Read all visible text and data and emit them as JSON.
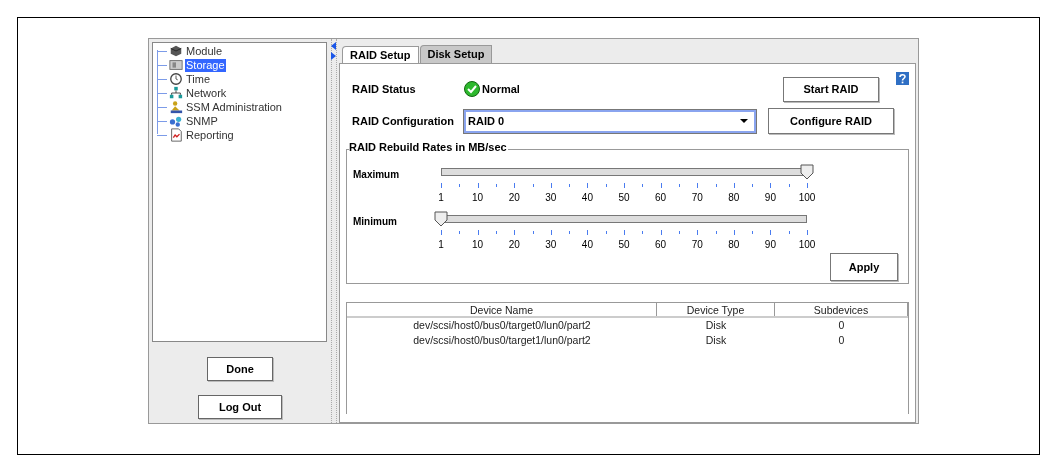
{
  "tree": [
    {
      "label": "Module",
      "kind": "module",
      "selected": false
    },
    {
      "label": "Storage",
      "kind": "storage",
      "selected": true
    },
    {
      "label": "Time",
      "kind": "time",
      "selected": false
    },
    {
      "label": "Network",
      "kind": "network",
      "selected": false
    },
    {
      "label": "SSM Administration",
      "kind": "admin",
      "selected": false
    },
    {
      "label": "SNMP",
      "kind": "snmp",
      "selected": false
    },
    {
      "label": "Reporting",
      "kind": "report",
      "selected": false
    }
  ],
  "side_buttons": [
    "Done",
    "Log Out"
  ],
  "tabs": [
    {
      "label": "RAID Setup",
      "selected": true
    },
    {
      "label": "Disk Setup",
      "selected": false
    }
  ],
  "raid_status": {
    "label": "RAID Status",
    "value": "Normal",
    "button": "Start RAID"
  },
  "raid_config": {
    "label": "RAID Configuration",
    "value": "RAID 0",
    "button": "Configure RAID"
  },
  "rebuild_rates": {
    "title": "RAID Rebuild Rates in MB/sec",
    "sliders": [
      {
        "label": "Maximum",
        "level": 1.0,
        "tick_labels": [
          "1",
          "10",
          "20",
          "30",
          "40",
          "50",
          "60",
          "70",
          "80",
          "90",
          "100"
        ]
      },
      {
        "label": "Minimum",
        "level": 0.0,
        "tick_labels": [
          "1",
          "10",
          "20",
          "30",
          "40",
          "50",
          "60",
          "70",
          "80",
          "90",
          "100"
        ]
      }
    ],
    "button": "Apply"
  },
  "table": {
    "columns": [
      "Device Name",
      "Device Type",
      "Subdevices"
    ],
    "rows": [
      [
        "dev/scsi/host0/bus0/target0/lun0/part2",
        "Disk",
        "0"
      ],
      [
        "dev/scsi/host0/bus0/target1/lun0/part2",
        "Disk",
        "0"
      ]
    ]
  }
}
